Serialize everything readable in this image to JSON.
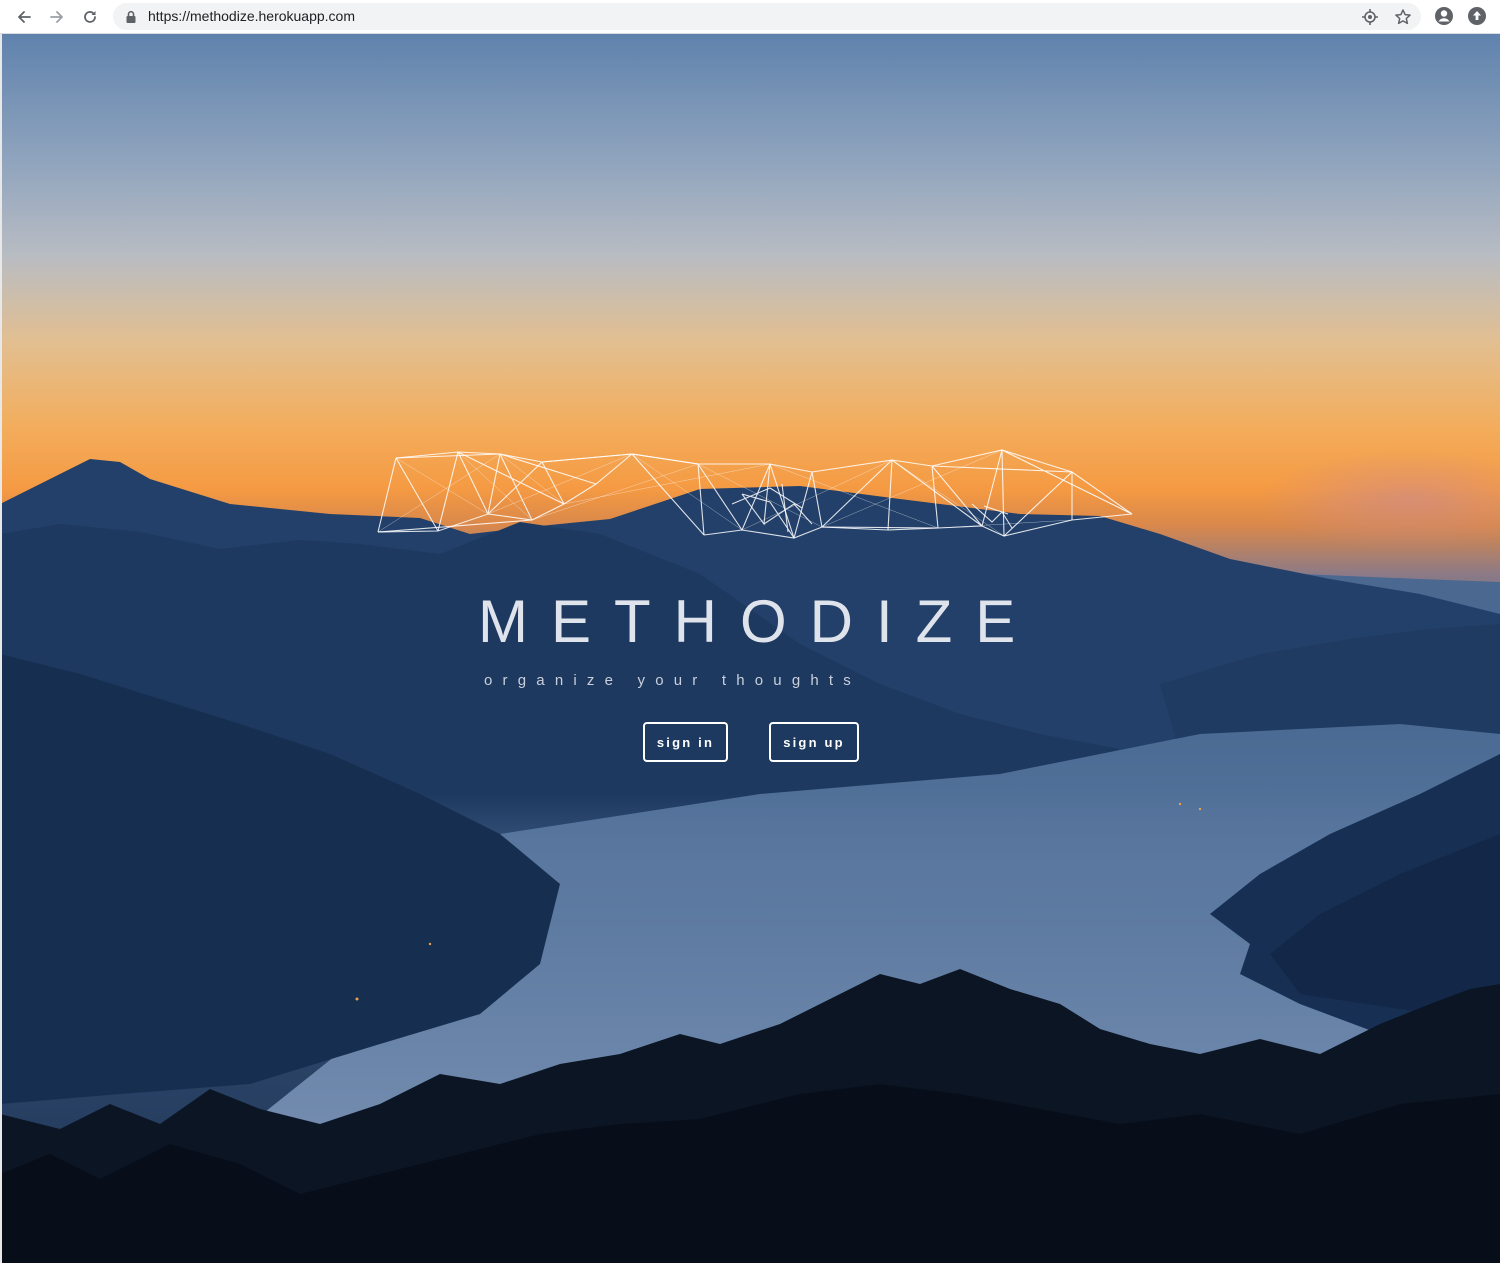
{
  "browser": {
    "url": "https://methodize.herokuapp.com",
    "icons": {
      "back": "arrow-left-icon",
      "forward": "arrow-right-icon",
      "reload": "reload-icon",
      "lock": "lock-icon",
      "location": "crosshair-icon",
      "bookmark": "star-icon",
      "profile": "account-icon",
      "extension": "upload-circle-icon"
    }
  },
  "hero": {
    "title": "METHODIZE",
    "tagline": "organize your thoughts",
    "sign_in_label": "sign in",
    "sign_up_label": "sign up",
    "background": "mountain lake at dusk",
    "logo": "network-mesh-logo"
  },
  "colors": {
    "sky_top": "#6e8db3",
    "sky_horizon": "#f4a64a",
    "mountain": "#1c3558",
    "text": "#dfe3eb"
  }
}
